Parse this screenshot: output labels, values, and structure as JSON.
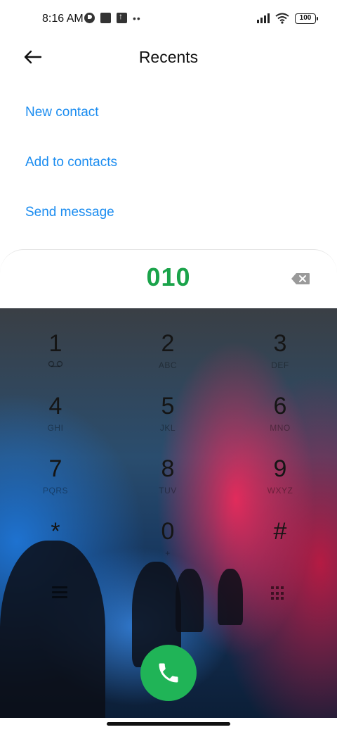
{
  "status_bar": {
    "time": "8:16 AM",
    "battery": "100",
    "left_icons": [
      "circle-icon",
      "square-icon",
      "upload-icon",
      "more-dots-icon"
    ],
    "right_icons": [
      "signal-icon",
      "wifi-icon",
      "battery-icon"
    ]
  },
  "header": {
    "title": "Recents",
    "back_icon": "back-arrow-icon"
  },
  "actions": {
    "new_contact": "New contact",
    "add_to_contacts": "Add to contacts",
    "send_message": "Send message"
  },
  "dialer": {
    "number": "010",
    "backspace_icon": "backspace-icon",
    "keys": [
      {
        "digit": "1",
        "letters": "voicemail"
      },
      {
        "digit": "2",
        "letters": "ABC"
      },
      {
        "digit": "3",
        "letters": "DEF"
      },
      {
        "digit": "4",
        "letters": "GHI"
      },
      {
        "digit": "5",
        "letters": "JKL"
      },
      {
        "digit": "6",
        "letters": "MNO"
      },
      {
        "digit": "7",
        "letters": "PQRS"
      },
      {
        "digit": "8",
        "letters": "TUV"
      },
      {
        "digit": "9",
        "letters": "WXYZ"
      },
      {
        "digit": "*",
        "letters": ""
      },
      {
        "digit": "0",
        "letters": "+"
      },
      {
        "digit": "#",
        "letters": ""
      }
    ],
    "menu_icon": "menu-icon",
    "grid_icon": "grid-icon",
    "call_icon": "phone-icon"
  },
  "colors": {
    "accent_link": "#1a8cf0",
    "number_green": "#1aa34a",
    "call_green": "#20b457"
  }
}
